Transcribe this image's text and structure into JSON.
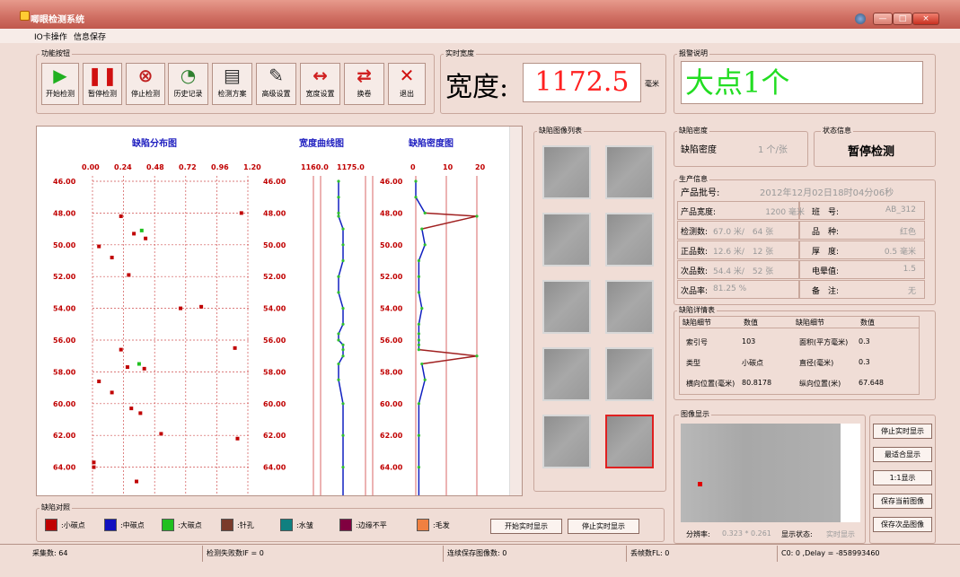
{
  "window": {
    "title": "唧眼检测系统",
    "min": "—",
    "max": "□",
    "close": "×"
  },
  "menu": [
    "IO卡操作",
    "信息保存"
  ],
  "toolbar": {
    "group_label": "功能按钮",
    "buttons": [
      {
        "label": "开始检测",
        "icon": "play-icon",
        "color": "#20b020"
      },
      {
        "label": "暂停检测",
        "icon": "pause-icon",
        "color": "#d01010"
      },
      {
        "label": "停止检测",
        "icon": "stop-icon",
        "color": "#c02020"
      },
      {
        "label": "历史记录",
        "icon": "history-icon",
        "color": "#308030"
      },
      {
        "label": "检测方案",
        "icon": "document-icon",
        "color": "#303030"
      },
      {
        "label": "高级设置",
        "icon": "settings-icon",
        "color": "#303030"
      },
      {
        "label": "宽度设置",
        "icon": "ruler-icon",
        "color": "#d02020"
      },
      {
        "label": "换卷",
        "icon": "swap-icon",
        "color": "#d02020"
      },
      {
        "label": "退出",
        "icon": "exit-icon",
        "color": "#d01010"
      }
    ]
  },
  "width_panel": {
    "group_label": "实时宽度",
    "label": "宽度:",
    "value": "1172.5",
    "unit": "毫米"
  },
  "alarm_panel": {
    "group_label": "报警说明",
    "text": "大点1个",
    "color": "#22dd22"
  },
  "chart": {
    "titles": [
      "缺陷分布图",
      "宽度曲线图",
      "缺陷密度图"
    ],
    "dist_ticks": [
      "0.00",
      "0.24",
      "0.48",
      "0.72",
      "0.96",
      "1.20"
    ],
    "width_ticks": [
      "1160.0",
      "1175.0"
    ],
    "density_ticks": [
      "0",
      "10",
      "20"
    ],
    "y_labels": [
      "46.00",
      "48.00",
      "50.00",
      "52.00",
      "54.00",
      "56.00",
      "58.00",
      "60.00",
      "62.00",
      "64.00"
    ]
  },
  "chart_data": {
    "type": "scatter",
    "defects": [
      {
        "x": 1.15,
        "y": 48.0
      },
      {
        "x": 0.22,
        "y": 48.2
      },
      {
        "x": 0.38,
        "y": 49.1,
        "c": "green"
      },
      {
        "x": 0.32,
        "y": 49.3
      },
      {
        "x": 0.41,
        "y": 49.6
      },
      {
        "x": 0.05,
        "y": 50.1
      },
      {
        "x": 0.15,
        "y": 50.8
      },
      {
        "x": 0.28,
        "y": 51.9
      },
      {
        "x": 0.84,
        "y": 53.9
      },
      {
        "x": 0.68,
        "y": 54.0
      },
      {
        "x": 1.1,
        "y": 56.5
      },
      {
        "x": 0.22,
        "y": 56.6
      },
      {
        "x": 0.36,
        "y": 57.5,
        "c": "green"
      },
      {
        "x": 0.27,
        "y": 57.7
      },
      {
        "x": 0.4,
        "y": 57.8
      },
      {
        "x": 0.05,
        "y": 58.6
      },
      {
        "x": 0.15,
        "y": 59.3
      },
      {
        "x": 0.3,
        "y": 60.3
      },
      {
        "x": 0.37,
        "y": 60.6
      },
      {
        "x": 0.53,
        "y": 61.9
      },
      {
        "x": 1.12,
        "y": 62.2
      },
      {
        "x": 0.01,
        "y": 63.7
      },
      {
        "x": 0.01,
        "y": 64.0
      },
      {
        "x": 0.34,
        "y": 64.9
      },
      {
        "x": 0.14,
        "y": 66.0
      },
      {
        "x": 0.18,
        "y": 66.1,
        "c": "blue"
      }
    ],
    "width": [
      1172,
      1172,
      1172,
      1172,
      1172.5,
      1172.5,
      1172.5,
      1172,
      1172,
      1172.5,
      1172.5,
      1172,
      1172,
      1172.5,
      1172.5,
      1172.5,
      1172,
      1172,
      1172.5,
      1172.5,
      1172.5,
      1172.5
    ],
    "density": [
      0,
      0,
      3,
      20,
      2,
      3,
      1,
      1,
      1,
      2,
      1,
      1,
      1,
      1,
      1,
      20,
      2,
      3,
      1,
      1,
      1,
      1
    ],
    "y": [
      46,
      47,
      48,
      48.2,
      49,
      50,
      51,
      52,
      53,
      54,
      55,
      55.6,
      56,
      56.3,
      56.6,
      57,
      57.5,
      58.5,
      60,
      62,
      64,
      66
    ]
  },
  "defect_list": {
    "group_label": "缺陷图像列表"
  },
  "density_panel": {
    "group_label": "缺陷密度",
    "label": "缺陷密度",
    "value": "1 个/张"
  },
  "state_panel": {
    "group_label": "状态信息",
    "value": "暂停检测"
  },
  "production": {
    "group_label": "生产信息",
    "batch_label": "产品批号:",
    "batch_value": "2012年12月02日18时04分06秒",
    "rows": [
      [
        "产品宽度:",
        "1200 毫米",
        "班　号:",
        "AB_312"
      ],
      [
        "检测数:",
        "67.0 米/　64 张",
        "品　种:",
        "红色"
      ],
      [
        "正品数:",
        "12.6 米/　12 张",
        "厚　度:",
        "0.5 毫米"
      ],
      [
        "次品数:",
        "54.4 米/　52 张",
        "电晕值:",
        "1.5"
      ],
      [
        "次品率:",
        "81.25 %",
        "备　注:",
        "无"
      ]
    ]
  },
  "detail": {
    "group_label": "缺陷详情表",
    "headers": [
      "缺陷细节",
      "数值",
      "缺陷细节",
      "数值"
    ],
    "rows": [
      [
        "索引号",
        "103",
        "面积(平方毫米)",
        "0.3"
      ],
      [
        "类型",
        "小碳点",
        "直径(毫米)",
        "0.3"
      ],
      [
        "横向位置(毫米)",
        "80.8178",
        "纵向位置(米)",
        "67.648"
      ]
    ]
  },
  "image_display": {
    "group_label": "图像显示",
    "resolution_label": "分辨率:",
    "resolution": "0.323 * 0.261",
    "state_label": "显示状态:",
    "state": "实时显示"
  },
  "image_buttons": [
    "停止实时显示",
    "最适合显示",
    "1:1显示",
    "保存当前图像",
    "保存次品图像"
  ],
  "legend": {
    "group_label": "缺陷对照",
    "items": [
      {
        "label": ":小碳点",
        "color": "#c00000"
      },
      {
        "label": ":中碳点",
        "color": "#1010c0"
      },
      {
        "label": ":大碳点",
        "color": "#20c020"
      },
      {
        "label": ":针孔",
        "color": "#7a3a2a"
      },
      {
        "label": ":水皱",
        "color": "#108080"
      },
      {
        "label": ":边缘不平",
        "color": "#800040"
      },
      {
        "label": ":毛发",
        "color": "#f08040"
      }
    ],
    "start_btn": "开始实时显示",
    "stop_btn": "停止实时显示"
  },
  "status": [
    "采集数: 64",
    "检测失败数IF = 0",
    "连续保存图像数: 0",
    "丢帧数FL: 0",
    "C0: 0 ,Delay = -858993460"
  ]
}
